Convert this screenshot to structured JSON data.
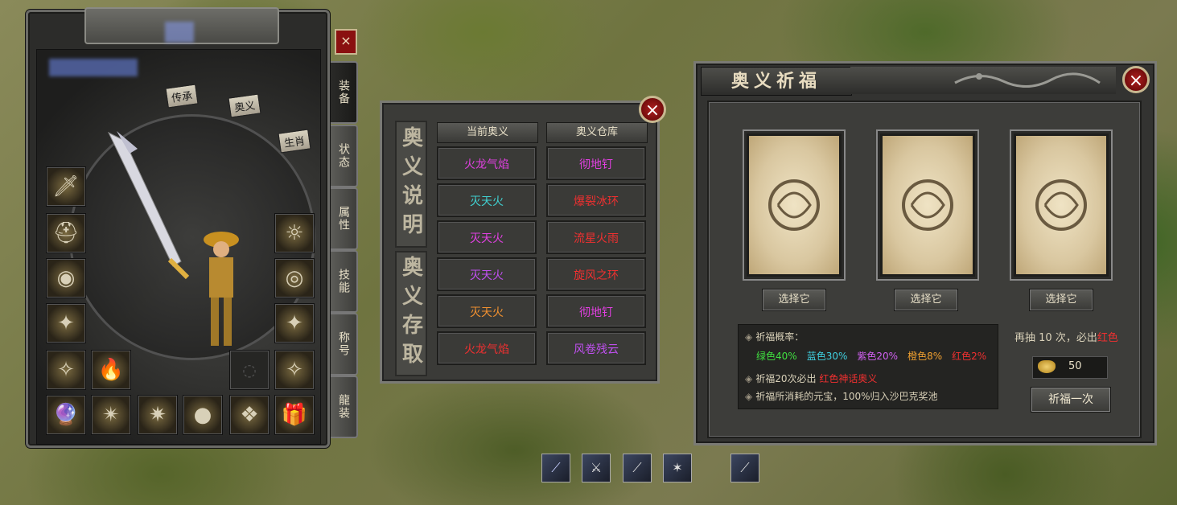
{
  "character_panel": {
    "close_label": "×",
    "buttons": {
      "inherit": "传承",
      "aoyi": "奥义",
      "zodiac": "生肖"
    },
    "tabs": [
      "装备",
      "状态",
      "属性",
      "技能",
      "称号",
      "龍装"
    ],
    "equipment_icons": [
      "weapon-icon",
      "helmet-icon",
      "necklace-icon",
      "armor-icon",
      "bracelet-left-icon",
      "bracelet-right-icon",
      "ring-left-icon",
      "ring-right-icon",
      "fire-icon",
      "medal-icon",
      "amulet-icon",
      "belt-icon",
      "boots-icon",
      "gem-icon",
      "orb-icon",
      "charm-icon",
      "treasure-icon"
    ]
  },
  "aoyi_panel": {
    "close_label": "×",
    "vertical_label_1": "奥义说明",
    "vertical_label_2": "奥义存取",
    "col_current": "当前奥义",
    "col_storage": "奥义仓库",
    "current": [
      {
        "name": "火龙气焰",
        "color": "#e040e0"
      },
      {
        "name": "灭天火",
        "color": "#40d0d0"
      },
      {
        "name": "灭天火",
        "color": "#e040e0"
      },
      {
        "name": "灭天火",
        "color": "#c050f0"
      },
      {
        "name": "灭天火",
        "color": "#f09030"
      },
      {
        "name": "火龙气焰",
        "color": "#f03030"
      }
    ],
    "storage": [
      {
        "name": "彻地钉",
        "color": "#e040e0"
      },
      {
        "name": "爆裂冰环",
        "color": "#f03030"
      },
      {
        "name": "流星火雨",
        "color": "#f03030"
      },
      {
        "name": "旋风之环",
        "color": "#f03030"
      },
      {
        "name": "彻地钉",
        "color": "#e040e0"
      },
      {
        "name": "风卷残云",
        "color": "#c050f0"
      }
    ]
  },
  "bless_panel": {
    "title": "奥义祈福",
    "close_label": "×",
    "pick_label": "选择它",
    "rate_title": "祈福概率：",
    "rates": [
      {
        "label": "绿色40%",
        "color": "#40e040"
      },
      {
        "label": "蓝色30%",
        "color": "#40d0e0"
      },
      {
        "label": "紫色20%",
        "color": "#d060f0"
      },
      {
        "label": "橙色8%",
        "color": "#f0a030"
      },
      {
        "label": "红色2%",
        "color": "#f03030"
      }
    ],
    "note1_prefix": "祈福20次必出",
    "note1_highlight": "红色神话奥义",
    "note2": "祈福所消耗的元宝，100%归入沙巴克奖池",
    "draw_prefix": "再抽",
    "draw_count": "10",
    "draw_middle": "次，必出",
    "draw_color": "红色",
    "cost": "50",
    "bless_once": "祈福一次"
  },
  "skills": [
    "lance-skill-icon",
    "blade-skill-icon",
    "sword-skill-icon",
    "beast-skill-icon",
    "dagger-skill-icon"
  ]
}
